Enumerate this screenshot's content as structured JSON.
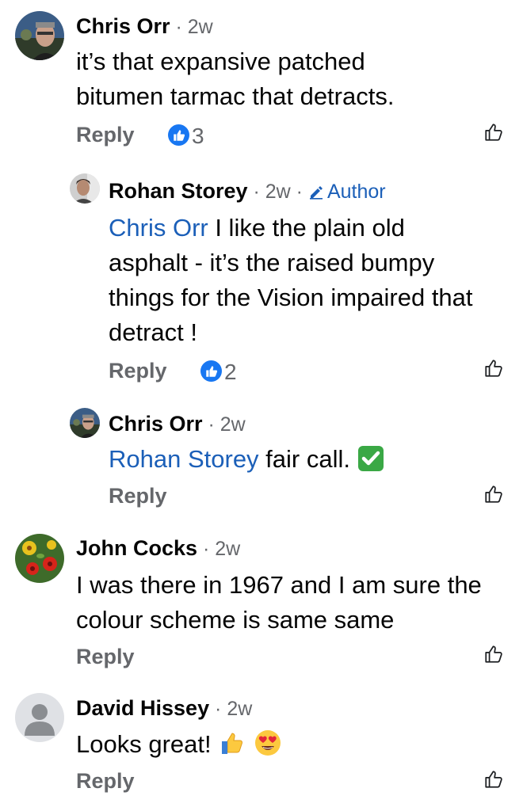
{
  "comments": [
    {
      "author": "Chris Orr",
      "time": "2w",
      "text": "it’s that expansive patched bitumen tarmac that detracts.",
      "reply_label": "Reply",
      "reaction_count": "3"
    },
    {
      "author": "Rohan Storey",
      "time": "2w",
      "badge": "Author",
      "mention": "Chris Orr",
      "text": " I like the plain old asphalt - it’s the raised bumpy things for the Vision impaired that detract !",
      "reply_label": "Reply",
      "reaction_count": "2"
    },
    {
      "author": "Chris Orr",
      "time": "2w",
      "mention": "Rohan Storey",
      "text": " fair call.",
      "reply_label": "Reply"
    },
    {
      "author": "John Cocks",
      "time": "2w",
      "text": "I was there in 1967 and I am sure the colour scheme is same same",
      "reply_label": "Reply"
    },
    {
      "author": "David Hissey",
      "time": "2w",
      "text": "Looks great!",
      "reply_label": "Reply"
    }
  ],
  "separator": " · ",
  "colors": {
    "text": "#050505",
    "secondary": "#65676b",
    "link": "#1b5fb8",
    "like_blue": "#1877f2",
    "check_green": "#3aa845"
  },
  "icons": [
    "like-reaction-icon",
    "like-outline-icon",
    "pencil-icon",
    "check-mark-emoji",
    "thumbs-up-emoji",
    "heart-eyes-emoji",
    "default-avatar-icon"
  ]
}
